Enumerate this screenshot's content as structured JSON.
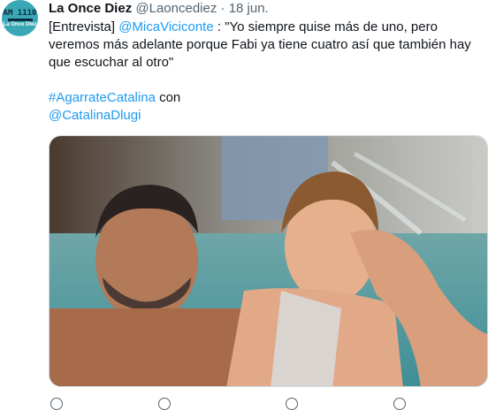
{
  "tweet": {
    "avatar": {
      "line1": "AM 1110",
      "line2": "La Once Diez"
    },
    "display_name": "La Once Diez",
    "handle": "@Laoncediez",
    "separator": "·",
    "date": "18 jun.",
    "text": {
      "prefix": "[Entrevista] ",
      "mention": "@MicaViciconte",
      "quote": " : \"Yo siempre quise más de uno, pero veremos más adelante porque Fabi ya tiene cuatro así que también hay que escuchar al otro\"",
      "hashtag": "#AgarrateCatalina",
      "with_word": " con",
      "mention2": "@CatalinaDlugi"
    },
    "colors": {
      "link": "#1d9bf0",
      "secondary_text": "#536471",
      "avatar_bg": "#3aa8b4"
    },
    "actions": [
      {
        "icon": "reply-icon"
      },
      {
        "icon": "retweet-icon"
      },
      {
        "icon": "like-icon"
      },
      {
        "icon": "share-icon"
      }
    ]
  }
}
